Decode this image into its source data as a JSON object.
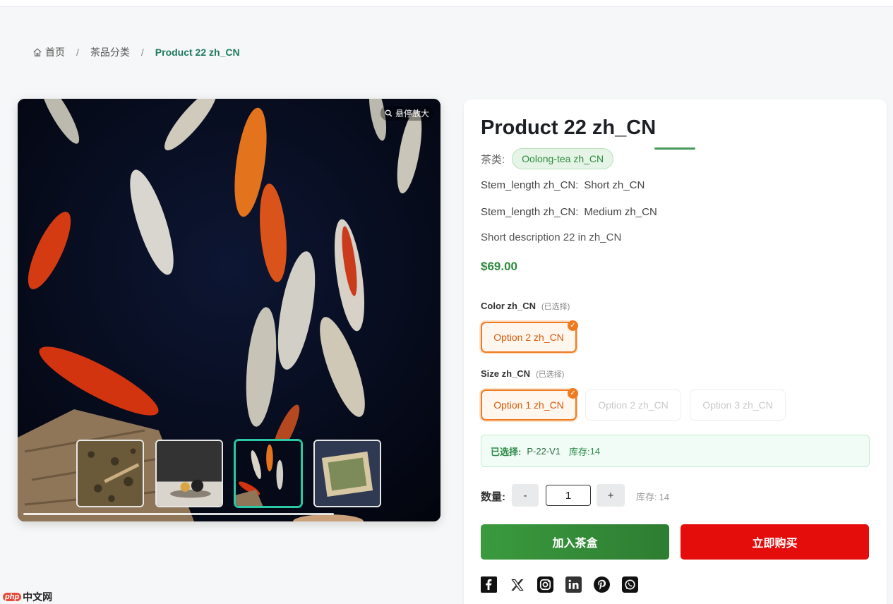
{
  "breadcrumb": {
    "home": "首页",
    "category": "茶品分类",
    "current": "Product 22 zh_CN"
  },
  "gallery": {
    "zoom_hint": "悬停放大",
    "thumbnails": [
      {
        "name": "loose-leaf-tea",
        "active": false
      },
      {
        "name": "teapot-set",
        "active": false
      },
      {
        "name": "koi-pond",
        "active": true
      },
      {
        "name": "green-tea-tray",
        "active": false
      }
    ]
  },
  "product": {
    "title": "Product 22 zh_CN",
    "tea_type_label": "茶类:",
    "tea_type": "Oolong-tea zh_CN",
    "attributes": [
      {
        "key": "Stem_length zh_CN:",
        "value": "Short zh_CN"
      },
      {
        "key": "Stem_length zh_CN:",
        "value": "Medium zh_CN"
      }
    ],
    "short_description": "Short description 22 in zh_CN",
    "price": "$69.00"
  },
  "options": {
    "color": {
      "label": "Color zh_CN",
      "hint": "(已选择)",
      "choices": [
        {
          "label": "Option 2 zh_CN",
          "state": "selected"
        }
      ]
    },
    "size": {
      "label": "Size zh_CN",
      "hint": "(已选择)",
      "choices": [
        {
          "label": "Option 1 zh_CN",
          "state": "selected"
        },
        {
          "label": "Option 2 zh_CN",
          "state": "disabled"
        },
        {
          "label": "Option 3 zh_CN",
          "state": "disabled"
        }
      ]
    }
  },
  "selection": {
    "label": "已选择:",
    "sku": "P-22-V1",
    "stock_label": "库存:",
    "stock": "14"
  },
  "quantity": {
    "label": "数量:",
    "minus": "-",
    "value": "1",
    "plus": "+",
    "stock_label": "库存:",
    "stock": "14"
  },
  "actions": {
    "add_to_cart": "加入茶盒",
    "buy_now": "立即购买"
  },
  "share": [
    "facebook-icon",
    "x-twitter-icon",
    "instagram-icon",
    "linkedin-icon",
    "pinterest-icon",
    "whatsapp-icon"
  ],
  "watermark": {
    "php": "php",
    "text": "中文网"
  },
  "colors": {
    "accent_green": "#2e8b3e",
    "selected_orange": "#ef7a1f",
    "buy_red": "#e50c0c",
    "thumb_active": "#2ac8a4"
  }
}
